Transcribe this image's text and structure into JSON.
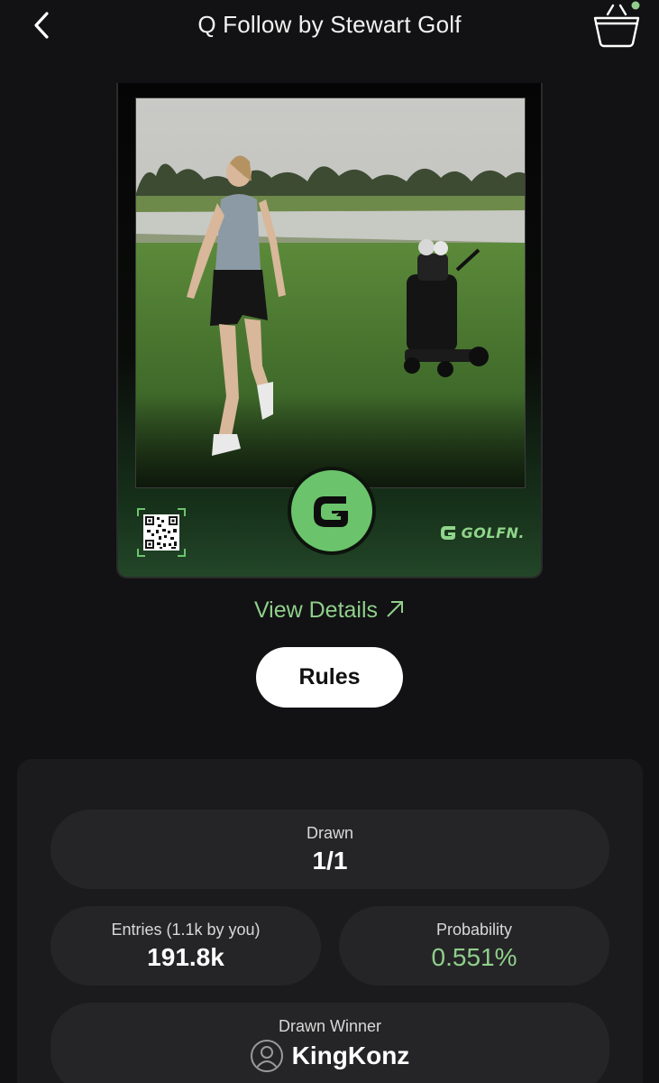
{
  "header": {
    "title": "Q Follow by Stewart Golf",
    "back_icon": "chevron-left-icon",
    "cart_icon": "basket-icon",
    "cart_dot_color": "#8fcf8a"
  },
  "card": {
    "brand_text": "GOLFN.",
    "accent_color": "#6bc46b"
  },
  "actions": {
    "view_details_label": "View Details",
    "rules_label": "Rules"
  },
  "stats": {
    "drawn_label": "Drawn",
    "drawn_value": "1/1",
    "entries_label": "Entries (1.1k by you)",
    "entries_value": "191.8k",
    "probability_label": "Probability",
    "probability_value": "0.551%",
    "winner_label": "Drawn Winner",
    "winner_name": "KingKonz"
  }
}
